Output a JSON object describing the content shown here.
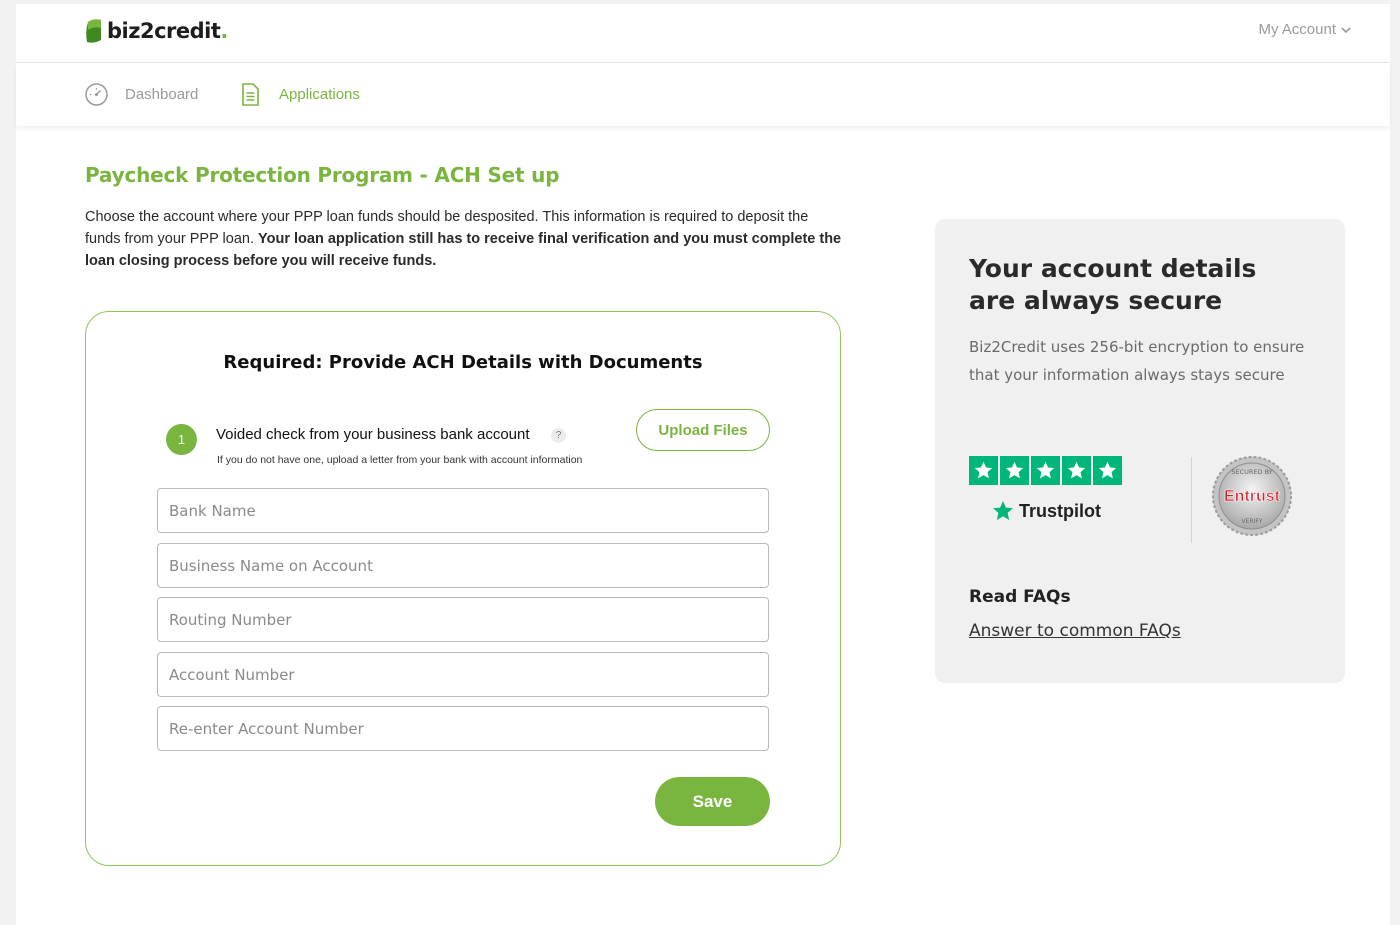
{
  "header": {
    "logo_text": "biz2credit",
    "logo_dot": ".",
    "my_account": "My Account"
  },
  "nav": {
    "dashboard": "Dashboard",
    "applications": "Applications"
  },
  "main": {
    "title": "Paycheck Protection Program - ACH Set up",
    "intro_plain": "Choose the account where your PPP loan funds should be desposited. This information is required to deposit the funds from your PPP loan. ",
    "intro_bold": "Your loan application still has to receive final verification and you must complete the loan closing process before you will receive funds."
  },
  "form": {
    "heading": "Required: Provide ACH Details with Documents",
    "step_number": "1",
    "step_title": "Voided check from your business bank account",
    "help_symbol": "?",
    "step_sub": "If you do not have one, upload a letter from your bank with account information",
    "upload_label": "Upload Files",
    "fields": {
      "bank_name": "Bank Name",
      "business_name": "Business Name on Account",
      "routing_number": "Routing Number",
      "account_number": "Account Number",
      "reenter_account": "Re-enter Account Number"
    },
    "save_label": "Save"
  },
  "side": {
    "title": "Your account details are always secure",
    "text": "Biz2Credit uses 256-bit encryption to ensure that your information always stays secure",
    "trustpilot": "Trustpilot",
    "trustpilot_rating_stars": 5,
    "seal_brand": "Entrust",
    "seal_top_text": "SECURED BY",
    "seal_bottom_text": "VERIFY",
    "faq_title": "Read FAQs",
    "faq_link": "Answer to common FAQs"
  },
  "colors": {
    "brand_green": "#7ab540",
    "trustpilot_green": "#00b67a",
    "seal_red": "#d8202a"
  },
  "icons": [
    "leaf-logo-icon",
    "chevron-down-icon",
    "speedometer-icon",
    "document-icon",
    "help-icon",
    "star-icon",
    "entrust-seal-icon"
  ]
}
